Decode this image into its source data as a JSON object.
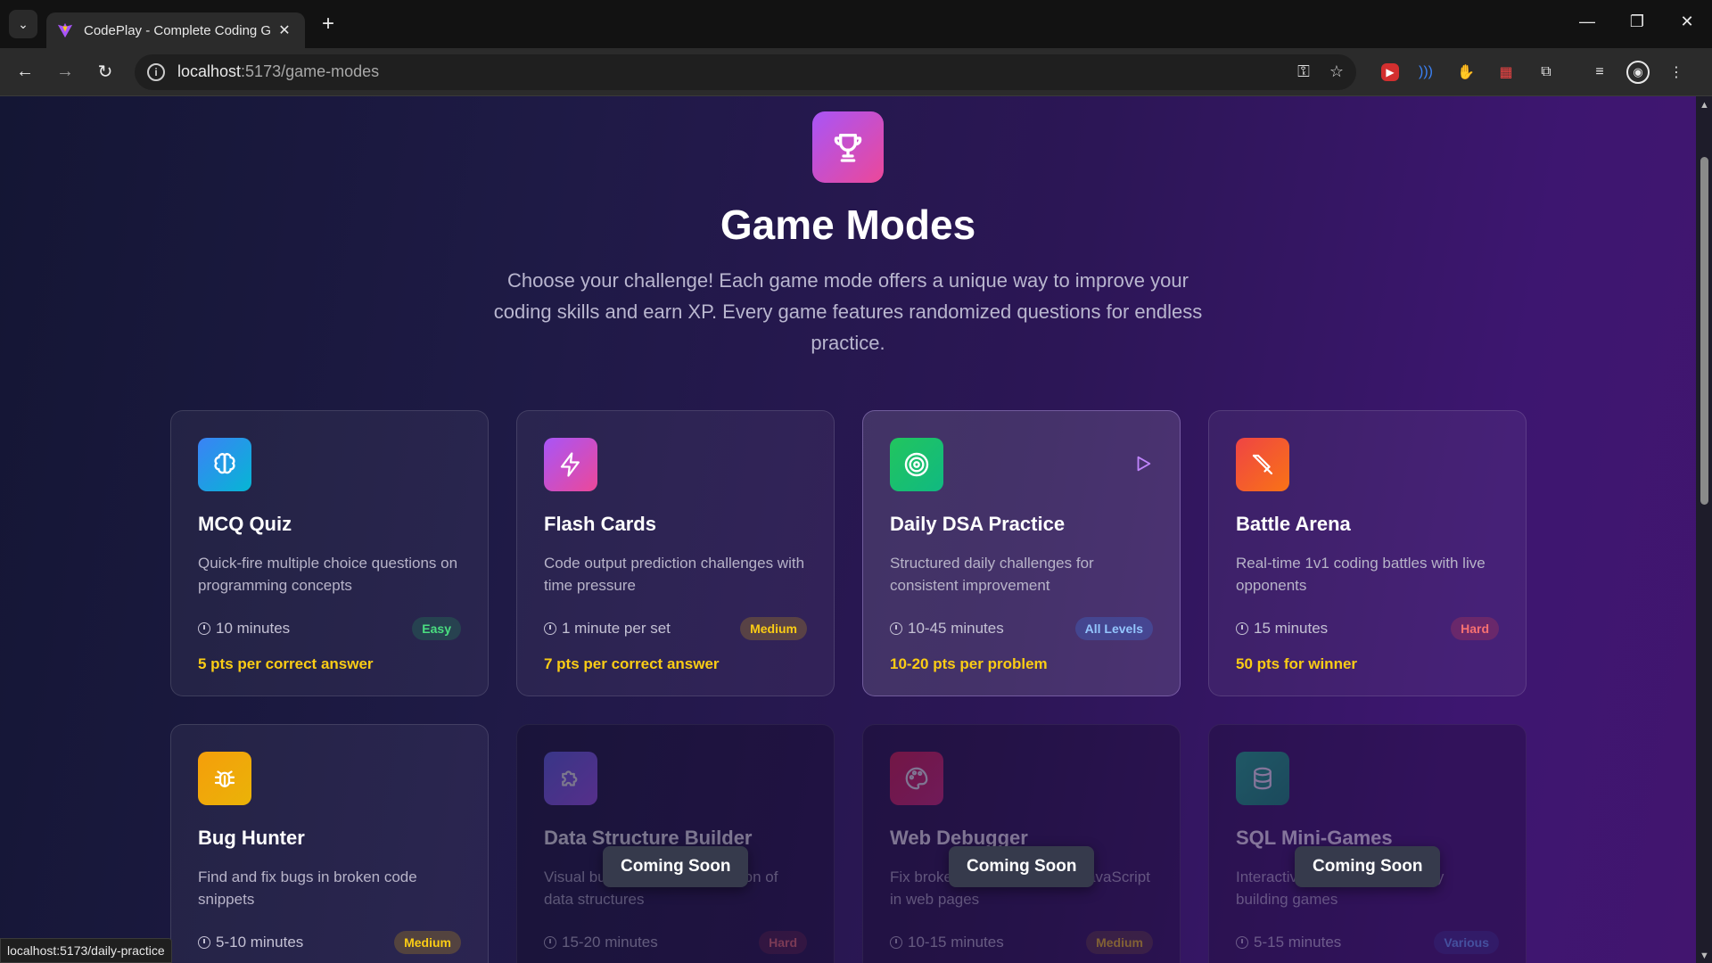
{
  "browser": {
    "tab_title": "CodePlay - Complete Coding G",
    "url_host": "localhost",
    "url_path": ":5173/game-modes",
    "status_url": "localhost:5173/daily-practice"
  },
  "hero": {
    "title": "Game Modes",
    "subtitle": "Choose your challenge! Each game mode offers a unique way to improve your coding skills and earn XP. Every game features randomized questions for endless practice."
  },
  "cards": [
    {
      "title": "MCQ Quiz",
      "desc": "Quick-fire multiple choice questions on programming concepts",
      "time": "10 minutes",
      "badge": "Easy",
      "points": "5 pts per correct answer",
      "icon": "brain-icon",
      "color": "#3b82f6"
    },
    {
      "title": "Flash Cards",
      "desc": "Code output prediction challenges with time pressure",
      "time": "1 minute per set",
      "badge": "Medium",
      "points": "7 pts per correct answer",
      "icon": "lightning-icon",
      "color": "#c026d3"
    },
    {
      "title": "Daily DSA Practice",
      "desc": "Structured daily challenges for consistent improvement",
      "time": "10-45 minutes",
      "badge": "All Levels",
      "points": "10-20 pts per problem",
      "icon": "target-icon",
      "color": "#22c55e"
    },
    {
      "title": "Battle Arena",
      "desc": "Real-time 1v1 coding battles with live opponents",
      "time": "15 minutes",
      "badge": "Hard",
      "points": "50 pts for winner",
      "icon": "sword-icon",
      "color": "#f97316"
    },
    {
      "title": "Bug Hunter",
      "desc": "Find and fix bugs in broken code snippets",
      "time": "5-10 minutes",
      "badge": "Medium",
      "icon": "bug-icon",
      "color": "#eab308"
    },
    {
      "title": "Data Structure Builder",
      "desc": "Visual building and manipulation of data structures",
      "time": "15-20 minutes",
      "badge": "Hard",
      "icon": "puzzle-icon",
      "color": "#6d28d9"
    },
    {
      "title": "Web Debugger",
      "desc": "Fix broken HTML, CSS and JavaScript in web pages",
      "time": "10-15 minutes",
      "badge": "Medium",
      "icon": "palette-icon",
      "color": "#be123c"
    },
    {
      "title": "SQL Mini-Games",
      "desc": "Interactive database and query building games",
      "time": "5-15 minutes",
      "badge": "Various",
      "icon": "database-icon",
      "color": "#059669"
    }
  ],
  "coming_soon": "Coming Soon"
}
